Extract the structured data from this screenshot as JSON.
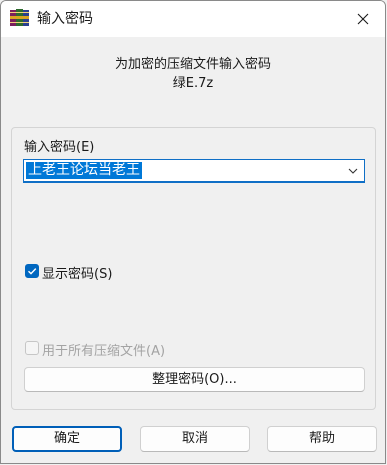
{
  "window": {
    "title": "输入密码",
    "close_icon": "close-icon",
    "app_icon": "winrar-books-icon"
  },
  "header": {
    "line1": "为加密的压缩文件输入密码",
    "line2": "绿E.7z"
  },
  "password": {
    "label": "输入密码(E)",
    "value": "上老王论坛当老王",
    "dropdown_icon": "chevron-down-icon"
  },
  "show_password": {
    "label": "显示密码(S)",
    "checked": true
  },
  "use_for_all": {
    "label": "用于所有压缩文件(A)",
    "checked": false,
    "disabled": true
  },
  "buttons": {
    "organize": "整理密码(O)...",
    "ok": "确定",
    "cancel": "取消",
    "help": "帮助"
  },
  "colors": {
    "accent": "#0067c0",
    "selection": "#0078d7",
    "background": "#f0f0f0"
  }
}
